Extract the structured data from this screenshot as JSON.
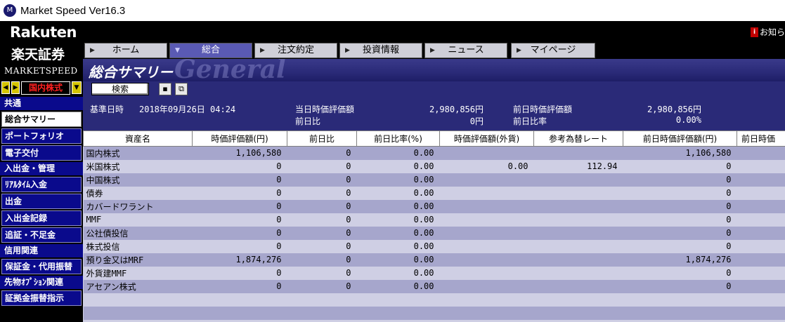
{
  "window": {
    "title": "Market Speed Ver16.3",
    "icon": "app-logo-icon"
  },
  "brand": {
    "line1": "Rakuten",
    "line2": "楽天証券",
    "line3": "MARKETSPEED"
  },
  "market_selector": {
    "value": "国内株式"
  },
  "notice": {
    "label": "お知ら",
    "icon": "info-icon"
  },
  "tabs": [
    {
      "label": "ホーム",
      "active": false
    },
    {
      "label": "総合",
      "active": true
    },
    {
      "label": "注文約定",
      "active": false
    },
    {
      "label": "投資情報",
      "active": false
    },
    {
      "label": "ニュース",
      "active": false
    },
    {
      "label": "マイページ",
      "active": false
    }
  ],
  "sidebar": {
    "sections": [
      {
        "header": "共通",
        "items": [
          "総合サマリー",
          "ポートフォリオ",
          "電子交付"
        ]
      },
      {
        "header": "入出金・管理",
        "items": [
          "ﾘｱﾙﾀｲﾑ入金",
          "出金",
          "入出金記録",
          "追証・不足金"
        ]
      },
      {
        "header": "信用関連",
        "items": [
          "保証金・代用振替"
        ]
      },
      {
        "header": "先物ｵﾌﾟｼｮﾝ関連",
        "items": [
          "証拠金振替指示"
        ]
      }
    ],
    "active_item": "総合サマリー"
  },
  "page": {
    "title": "総合サマリー",
    "ghost_text": "General"
  },
  "toolbar": {
    "search_label": "検索",
    "save_icon": "save-icon",
    "copy_icon": "copy-icon"
  },
  "info": {
    "base_datetime_label": "基準日時",
    "base_datetime_value": "2018年09月26日 04:24",
    "today_value_label": "当日時価評価額",
    "today_value": "2,980,856円",
    "day_change_label": "前日比",
    "day_change_value": "0円",
    "prev_value_label": "前日時価評価額",
    "prev_value": "2,980,856円",
    "prev_ratio_label": "前日比率",
    "prev_ratio_value": "0.00%"
  },
  "table": {
    "columns": [
      "資産名",
      "時価評価額(円)",
      "前日比",
      "前日比率(%)",
      "時価評価額(外貨)",
      "参考為替レート",
      "前日時価評価額(円)",
      "前日時価"
    ],
    "rows": [
      [
        "国内株式",
        "1,106,580",
        "0",
        "0.00",
        "",
        "",
        "1,106,580",
        ""
      ],
      [
        "米国株式",
        "0",
        "0",
        "0.00",
        "0.00",
        "112.94",
        "0",
        ""
      ],
      [
        "中国株式",
        "0",
        "0",
        "0.00",
        "",
        "",
        "0",
        ""
      ],
      [
        "債券",
        "0",
        "0",
        "0.00",
        "",
        "",
        "0",
        ""
      ],
      [
        "カバードワラント",
        "0",
        "0",
        "0.00",
        "",
        "",
        "0",
        ""
      ],
      [
        "MMF",
        "0",
        "0",
        "0.00",
        "",
        "",
        "0",
        ""
      ],
      [
        "公社債投信",
        "0",
        "0",
        "0.00",
        "",
        "",
        "0",
        ""
      ],
      [
        "株式投信",
        "0",
        "0",
        "0.00",
        "",
        "",
        "0",
        ""
      ],
      [
        "預り金又はMRF",
        "1,874,276",
        "0",
        "0.00",
        "",
        "",
        "1,874,276",
        ""
      ],
      [
        "外貨建MMF",
        "0",
        "0",
        "0.00",
        "",
        "",
        "0",
        ""
      ],
      [
        "アセアン株式",
        "0",
        "0",
        "0.00",
        "",
        "",
        "0",
        ""
      ]
    ]
  },
  "colors": {
    "navy": "#0a0a8c",
    "header_blue": "#2a2a78",
    "row_odd": "#a6a6cc",
    "row_even": "#cfcfe4",
    "market_text": "#ff2020"
  }
}
